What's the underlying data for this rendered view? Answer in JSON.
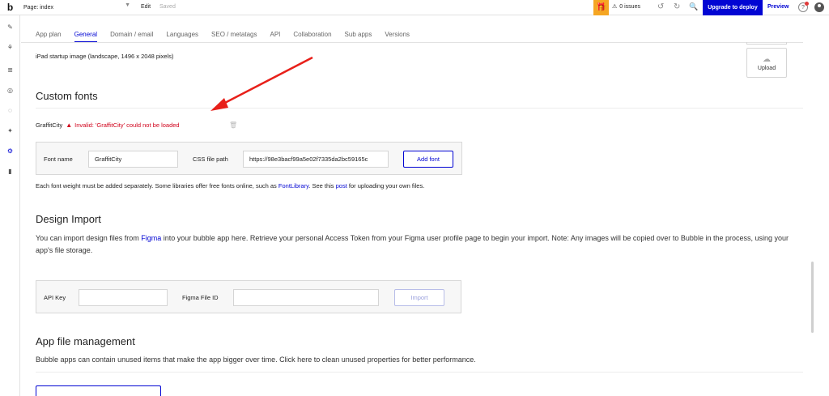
{
  "topbar": {
    "logo": "b",
    "page_select": "Page: index",
    "edit": "Edit",
    "saved": "Saved",
    "issues": "0 issues",
    "upgrade": "Upgrade to deploy",
    "preview": "Preview"
  },
  "tabs": [
    "App plan",
    "General",
    "Domain / email",
    "Languages",
    "SEO / metatags",
    "API",
    "Collaboration",
    "Sub apps",
    "Versions"
  ],
  "ipad": {
    "label": "iPad startup image (landscape, 1496 x 2048 pixels)",
    "upload": "Upload"
  },
  "custom_fonts": {
    "title": "Custom fonts",
    "font_name": "GraffitCity",
    "error": "Invalid: 'GraffitCity' could not be loaded",
    "font_name_label": "Font name",
    "font_name_value": "GraffitCity",
    "css_label": "CSS file path",
    "css_value": "https://98e3bacf99a5e02f7335da2bc59165c",
    "add_font": "Add font",
    "note_before": "Each font weight must be added separately. Some libraries offer free fonts online, such as ",
    "note_link1": "FontLibrary",
    "note_mid": ". See this ",
    "note_link2": "post",
    "note_after": " for uploading your own files."
  },
  "design_import": {
    "title": "Design Import",
    "desc_before": "You can import design files from ",
    "desc_link": "Figma",
    "desc_after": " into your bubble app here. Retrieve your personal Access Token from your Figma user profile page to begin your import. Note: Any images will be copied over to Bubble in the process, using your app's file storage.",
    "api_key_label": "API Key",
    "figma_id_label": "Figma File ID",
    "import": "Import"
  },
  "file_mgmt": {
    "title": "App file management",
    "desc": "Bubble apps can contain unused items that make the app bigger over time. Click here to clean unused properties for better performance."
  }
}
